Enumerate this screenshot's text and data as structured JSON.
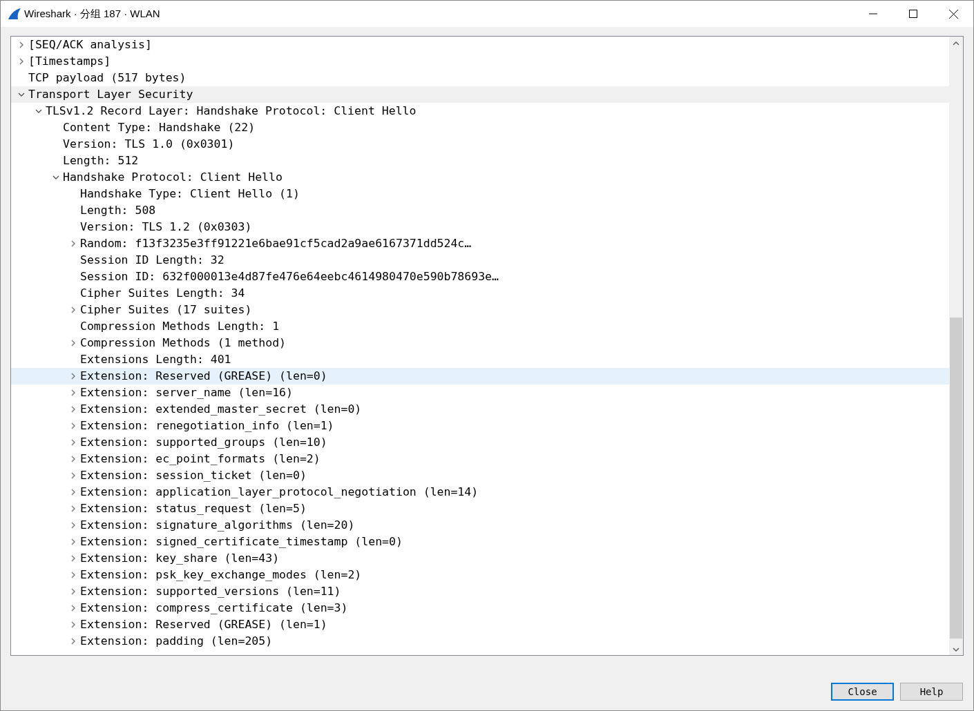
{
  "window": {
    "title": "Wireshark · 分组 187 · WLAN"
  },
  "tree": [
    {
      "children": [
        {
          "label": "[SEQ/ACK analysis]",
          "selected": false,
          "hovered": false,
          "expanded": false,
          "expandable": true
        },
        {
          "label": "[Timestamps]",
          "selected": false,
          "hovered": false,
          "expanded": false,
          "expandable": true
        },
        {
          "label": "TCP payload (517 bytes)",
          "selected": false,
          "hovered": false
        }
      ]
    },
    {
      "label": "Transport Layer Security",
      "selected": false,
      "hovered": true,
      "expanded": true,
      "expandable": true,
      "children": [
        {
          "label": "TLSv1.2 Record Layer: Handshake Protocol: Client Hello",
          "selected": false,
          "hovered": false,
          "expanded": true,
          "expandable": true,
          "children": [
            {
              "label": "Content Type: Handshake (22)",
              "selected": false,
              "hovered": false
            },
            {
              "label": "Version: TLS 1.0 (0x0301)",
              "selected": false,
              "hovered": false
            },
            {
              "label": "Length: 512",
              "selected": false,
              "hovered": false
            },
            {
              "label": "Handshake Protocol: Client Hello",
              "selected": false,
              "hovered": false,
              "expanded": true,
              "expandable": true,
              "children": [
                {
                  "label": "Handshake Type: Client Hello (1)",
                  "selected": false,
                  "hovered": false
                },
                {
                  "label": "Length: 508",
                  "selected": false,
                  "hovered": false
                },
                {
                  "label": "Version: TLS 1.2 (0x0303)",
                  "selected": false,
                  "hovered": false
                },
                {
                  "label": "Random: f13f3235e3ff91221e6bae91cf5cad2a9ae6167371dd524c…",
                  "selected": false,
                  "hovered": false,
                  "expanded": false,
                  "expandable": true
                },
                {
                  "label": "Session ID Length: 32",
                  "selected": false,
                  "hovered": false
                },
                {
                  "label": "Session ID: 632f000013e4d87fe476e64eebc4614980470e590b78693e…",
                  "selected": false,
                  "hovered": false
                },
                {
                  "label": "Cipher Suites Length: 34",
                  "selected": false,
                  "hovered": false
                },
                {
                  "label": "Cipher Suites (17 suites)",
                  "selected": false,
                  "hovered": false,
                  "expanded": false,
                  "expandable": true
                },
                {
                  "label": "Compression Methods Length: 1",
                  "selected": false,
                  "hovered": false
                },
                {
                  "label": "Compression Methods (1 method)",
                  "selected": false,
                  "hovered": false,
                  "expanded": false,
                  "expandable": true
                },
                {
                  "label": "Extensions Length: 401",
                  "selected": false,
                  "hovered": false
                },
                {
                  "label": "Extension: Reserved (GREASE) (len=0)",
                  "selected": true,
                  "hovered": false,
                  "expanded": false,
                  "expandable": true
                },
                {
                  "label": "Extension: server_name (len=16)",
                  "selected": false,
                  "hovered": false,
                  "expanded": false,
                  "expandable": true
                },
                {
                  "label": "Extension: extended_master_secret (len=0)",
                  "selected": false,
                  "hovered": false,
                  "expanded": false,
                  "expandable": true
                },
                {
                  "label": "Extension: renegotiation_info (len=1)",
                  "selected": false,
                  "hovered": false,
                  "expanded": false,
                  "expandable": true
                },
                {
                  "label": "Extension: supported_groups (len=10)",
                  "selected": false,
                  "hovered": false,
                  "expanded": false,
                  "expandable": true
                },
                {
                  "label": "Extension: ec_point_formats (len=2)",
                  "selected": false,
                  "hovered": false,
                  "expanded": false,
                  "expandable": true
                },
                {
                  "label": "Extension: session_ticket (len=0)",
                  "selected": false,
                  "hovered": false,
                  "expanded": false,
                  "expandable": true
                },
                {
                  "label": "Extension: application_layer_protocol_negotiation (len=14)",
                  "selected": false,
                  "hovered": false,
                  "expanded": false,
                  "expandable": true
                },
                {
                  "label": "Extension: status_request (len=5)",
                  "selected": false,
                  "hovered": false,
                  "expanded": false,
                  "expandable": true
                },
                {
                  "label": "Extension: signature_algorithms (len=20)",
                  "selected": false,
                  "hovered": false,
                  "expanded": false,
                  "expandable": true
                },
                {
                  "label": "Extension: signed_certificate_timestamp (len=0)",
                  "selected": false,
                  "hovered": false,
                  "expanded": false,
                  "expandable": true
                },
                {
                  "label": "Extension: key_share (len=43)",
                  "selected": false,
                  "hovered": false,
                  "expanded": false,
                  "expandable": true
                },
                {
                  "label": "Extension: psk_key_exchange_modes (len=2)",
                  "selected": false,
                  "hovered": false,
                  "expanded": false,
                  "expandable": true
                },
                {
                  "label": "Extension: supported_versions (len=11)",
                  "selected": false,
                  "hovered": false,
                  "expanded": false,
                  "expandable": true
                },
                {
                  "label": "Extension: compress_certificate (len=3)",
                  "selected": false,
                  "hovered": false,
                  "expanded": false,
                  "expandable": true
                },
                {
                  "label": "Extension: Reserved (GREASE) (len=1)",
                  "selected": false,
                  "hovered": false,
                  "expanded": false,
                  "expandable": true
                },
                {
                  "label": "Extension: padding (len=205)",
                  "selected": false,
                  "hovered": false,
                  "expanded": false,
                  "expandable": true
                }
              ]
            }
          ]
        }
      ]
    }
  ],
  "buttons": [
    {
      "label": "Close",
      "focused": true
    },
    {
      "label": "Help",
      "focused": false
    }
  ]
}
